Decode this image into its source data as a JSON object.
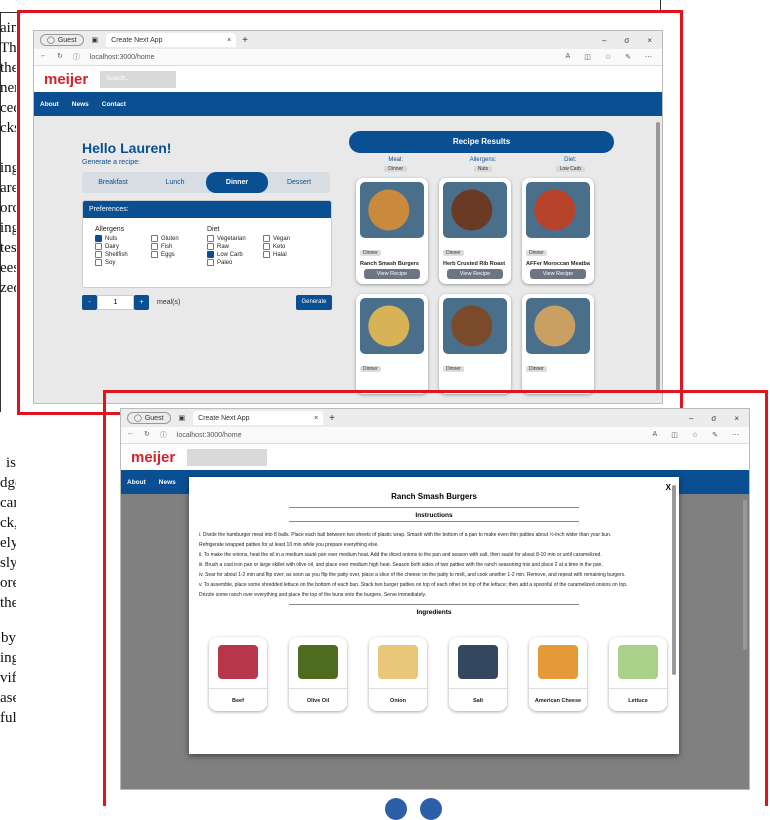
{
  "background_text": [
    "ain",
    "The",
    "the",
    "ner",
    "ced",
    "cks",
    "ing",
    "are,",
    "ord.",
    "ing",
    "tes",
    "ees,",
    "zed",
    "is",
    "dge",
    "can",
    "ck,",
    "ely",
    "sly",
    "ore",
    "the",
    "by",
    "ing",
    "vift",
    "ase",
    "ful"
  ],
  "browser": {
    "profile": "Guest",
    "tab_title": "Create Next App",
    "url": "localhost:3000/home",
    "window_controls": [
      "–",
      "σ",
      "×"
    ]
  },
  "app": {
    "logo": "meijer",
    "search_placeholder": "Search...",
    "nav": [
      "About",
      "News",
      "Contact"
    ],
    "greeting": "Hello Lauren!",
    "generate_label": "Generate a recipe:",
    "meal_tabs": [
      "Breakfast",
      "Lunch",
      "Dinner",
      "Dessert"
    ],
    "active_meal": "Dinner",
    "preferences": {
      "title": "Preferences:",
      "allergens_title": "Allergens",
      "allergens": [
        {
          "label": "Nuts",
          "checked": true
        },
        {
          "label": "Gluten",
          "checked": false
        },
        {
          "label": "Dairy",
          "checked": false
        },
        {
          "label": "Fish",
          "checked": false
        },
        {
          "label": "Shellfish",
          "checked": false
        },
        {
          "label": "Eggs",
          "checked": false
        },
        {
          "label": "Soy",
          "checked": false
        }
      ],
      "diet_title": "Diet",
      "diet": [
        {
          "label": "Vegetarian",
          "checked": false
        },
        {
          "label": "Vegan",
          "checked": false
        },
        {
          "label": "Raw",
          "checked": false
        },
        {
          "label": "Keto",
          "checked": false
        },
        {
          "label": "Low Carb",
          "checked": true
        },
        {
          "label": "Halal",
          "checked": false
        },
        {
          "label": "Paleo",
          "checked": false
        }
      ]
    },
    "counter": {
      "minus": "-",
      "value": "1",
      "plus": "+",
      "label": "meal(s)"
    },
    "generate_button": "Generate",
    "results": {
      "title": "Recipe Results",
      "meal_label": "Meal:",
      "meal_value": "Dinner",
      "allergens_label": "Allergens:",
      "allergens_value": "Nuts",
      "diet_label": "Diet:",
      "diet_value": "Low Carb",
      "view_label": "View Recipe",
      "cards": [
        {
          "tag": "Dinner",
          "name": "Ranch Smash Burgers",
          "color": "#c98a3e"
        },
        {
          "tag": "Dinner",
          "name": "Herb Crusted Rib Roast",
          "color": "#6b3a24"
        },
        {
          "tag": "Dinner",
          "name": "AFFer Moroccan Meatballs",
          "color": "#b7432b"
        },
        {
          "tag": "Dinner",
          "name": "",
          "color": "#d7b257"
        },
        {
          "tag": "Dinner",
          "name": "",
          "color": "#7a4a2a"
        },
        {
          "tag": "Dinner",
          "name": "",
          "color": "#c9a062"
        }
      ]
    }
  },
  "modal": {
    "title": "Ranch Smash Burgers",
    "close": "X",
    "instructions_title": "Instructions",
    "steps": [
      "i. Divide the hamburger meat into 8 balls. Place each ball between two sheets of plastic wrap. Smash with the bottom of a pan to make even thin patties about ½-inch wider than your bun.",
      "Refrigerate wrapped patties for at least 10 min while you prepare everything else.",
      "ii. To make the onions, heat the oil in a medium sauté pan over medium heat. Add the diced onions to the pan and season with salt, then sauté for about 8-10 min or until caramelized.",
      "iii. Brush a cast iron pan or large skillet with olive oil, and place over medium high heat. Season both sides of two patties with the ranch seasoning mix and place 2 at a time in the pan.",
      "iv. Sear for about 1-2 min and flip over; as soon as you flip the patty over, place a slice of the cheese on the patty to melt, and cook another 1-2 min. Remove, and repeat with remaining burgers.",
      "v. To assemble, place some shredded lettuce on the bottom of each bun. Stack two burger patties on top of each other on top of the lettuce; then add a spoonful of the caramelized onions on top.",
      "Drizzle some ranch over everything and place the top of the buns onto the burgers. Serve immediately."
    ],
    "ingredients_title": "Ingredients",
    "ingredients": [
      {
        "name": "Beef",
        "color": "#b8364a"
      },
      {
        "name": "Olive Oil",
        "color": "#4f6b1e"
      },
      {
        "name": "Onion",
        "color": "#e8c77a"
      },
      {
        "name": "Salt",
        "color": "#33485f"
      },
      {
        "name": "American Cheese",
        "color": "#e59a3a"
      },
      {
        "name": "Lettuce",
        "color": "#a9d18a"
      }
    ]
  }
}
